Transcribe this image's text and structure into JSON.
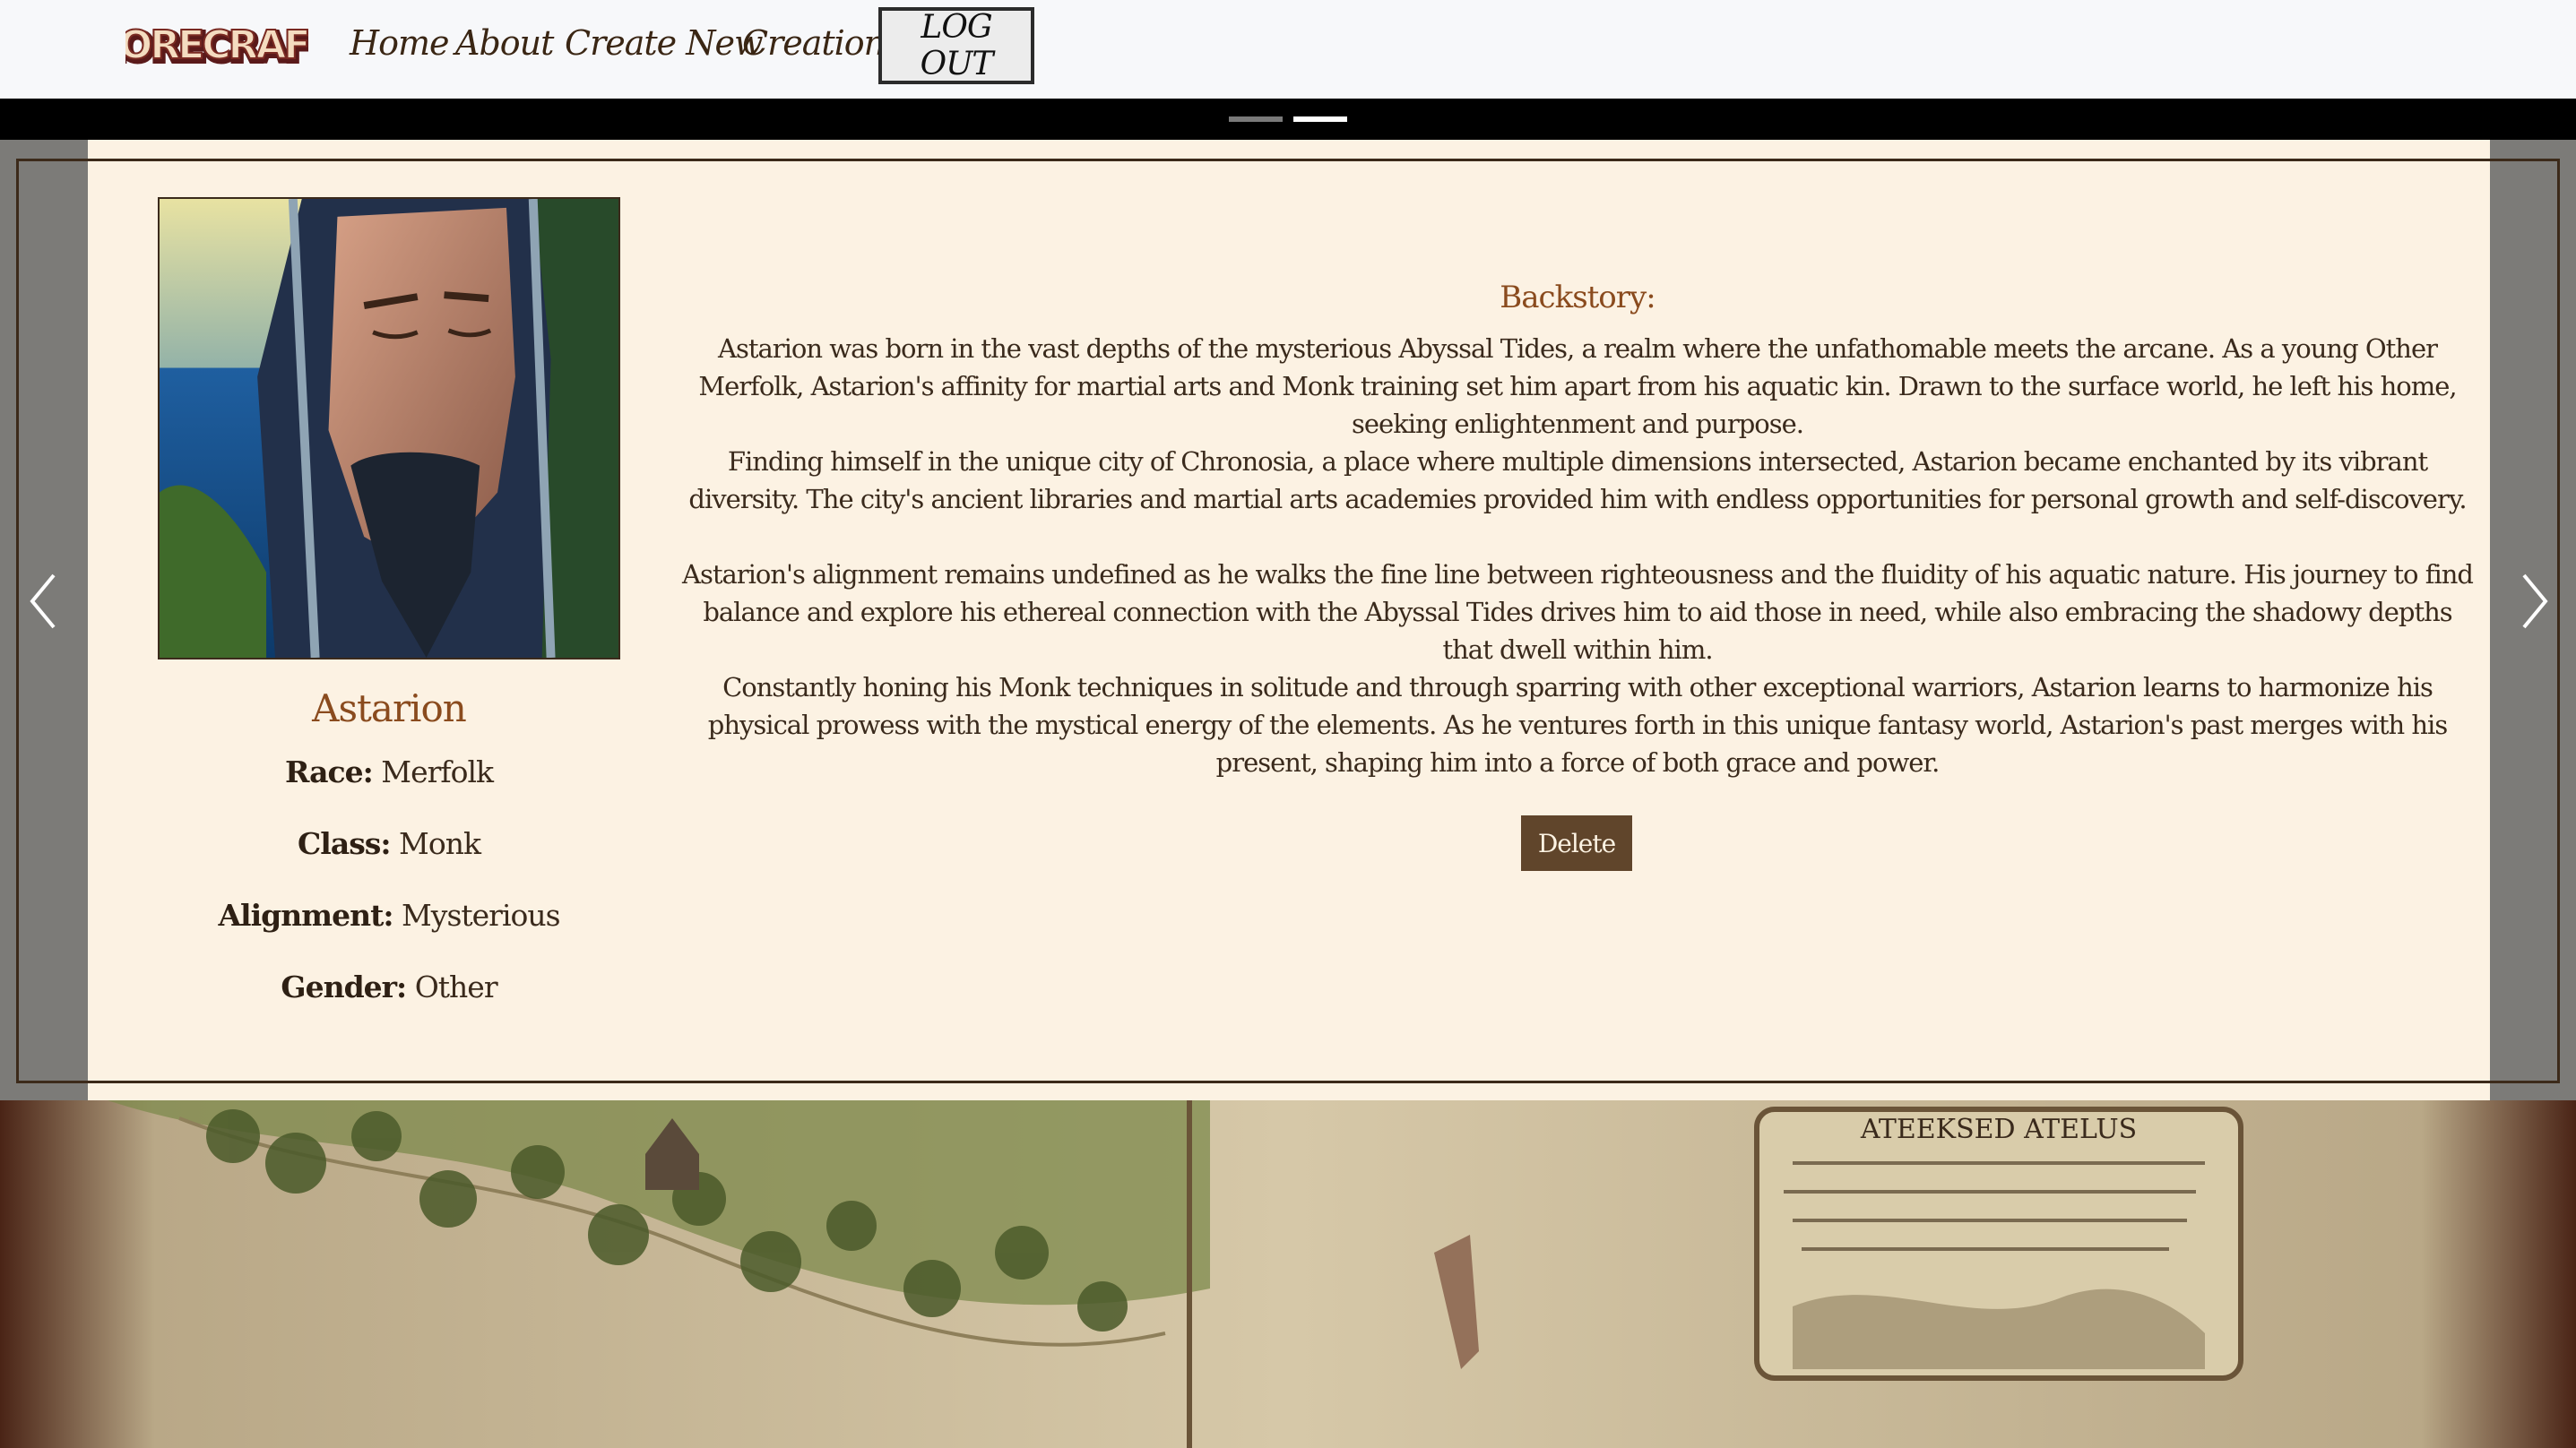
{
  "nav": {
    "logo_text": "LORECRAFT",
    "links": [
      "Home",
      "About",
      "Create New",
      "Creations"
    ],
    "logout_label": "LOG OUT"
  },
  "carousel": {
    "indicators": 2,
    "active_indicator": 2
  },
  "character": {
    "name": "Astarion",
    "stats": [
      {
        "label": "Race:",
        "value": "Merfolk"
      },
      {
        "label": "Class:",
        "value": "Monk"
      },
      {
        "label": "Alignment:",
        "value": "Mysterious"
      },
      {
        "label": "Gender:",
        "value": "Other"
      }
    ],
    "backstory_heading": "Backstory:",
    "backstory": [
      "Astarion was born in the vast depths of the mysterious Abyssal Tides, a realm where the unfathomable meets the arcane. As a young Other Merfolk, Astarion's affinity for martial arts and Monk training set him apart from his aquatic kin. Drawn to the surface world, he left his home, seeking enlightenment and purpose.",
      "Finding himself in the unique city of Chronosia, a place where multiple dimensions intersected, Astarion became enchanted by its vibrant diversity. The city's ancient libraries and martial arts academies provided him with endless opportunities for personal growth and self-discovery.",
      "Astarion's alignment remains undefined as he walks the fine line between righteousness and the fluidity of his aquatic nature. His journey to find balance and explore his ethereal connection with the Abyssal Tides drives him to aid those in need, while also embracing the shadowy depths that dwell within him.",
      "Constantly honing his Monk techniques in solitude and through sparring with other exceptional warriors, Astarion learns to harmonize his physical prowess with the mystical energy of the elements. As he ventures forth in this unique fantasy world, Astarion's past merges with his present, shaping him into a force of both grace and power."
    ],
    "delete_label": "Delete"
  },
  "background_map": {
    "title_text": "ATEEKSED ATELUS"
  },
  "colors": {
    "accent": "#8a4b1e",
    "card_bg": "#fcf2e3",
    "button_bg": "#60452b",
    "side_bg": "#7c7b78"
  }
}
